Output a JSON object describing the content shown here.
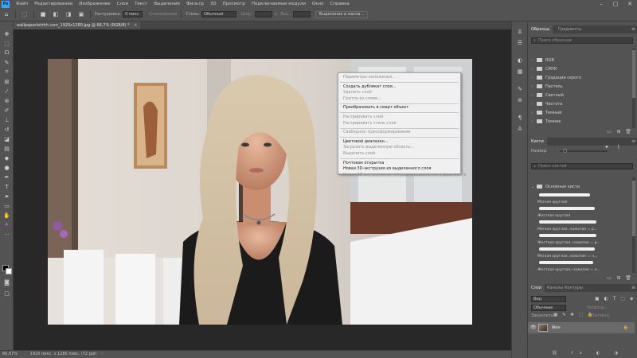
{
  "app": {
    "logo": "Ps"
  },
  "menubar": {
    "items": [
      "Файл",
      "Редактирование",
      "Изображение",
      "Слои",
      "Текст",
      "Выделение",
      "Фильтр",
      "3D",
      "Просмотр",
      "Подключаемые модули",
      "Окно",
      "Справка"
    ],
    "window_controls": [
      "–",
      "□",
      "✕"
    ]
  },
  "options": {
    "feather_label": "Растушевка:",
    "feather_value": "0 пикс.",
    "antialias_label": "Сглаживание",
    "style_label": "Стиль:",
    "style_value": "Обычный",
    "width_label": "Шир.:",
    "height_label": "Выс.:",
    "select_mask_button": "Выделение и маска..."
  },
  "document": {
    "tab_title": "wallpapertotrhh.com_1920x1280.jpg @ 66,7% (RGB/8) *"
  },
  "context_menu": {
    "groups": [
      [
        {
          "label": "Параметры наложения...",
          "enabled": false
        }
      ],
      [
        {
          "label": "Создать дубликат слоя...",
          "enabled": true
        },
        {
          "label": "Удалить слой",
          "enabled": false
        },
        {
          "label": "Группа из слоев...",
          "enabled": false
        }
      ],
      [
        {
          "label": "Преобразовать в смарт-объект",
          "enabled": true
        }
      ],
      [
        {
          "label": "Растрировать слой",
          "enabled": false
        },
        {
          "label": "Растрировать стиль слоя",
          "enabled": false
        }
      ],
      [
        {
          "label": "Свободное трансформирование",
          "enabled": false
        }
      ],
      [
        {
          "label": "Цветовой диапазон...",
          "enabled": true
        },
        {
          "label": "Загрузить выделенную область...",
          "enabled": false
        },
        {
          "label": "Выделить слой",
          "enabled": false
        }
      ],
      [
        {
          "label": "Почтовая открытка",
          "enabled": true
        },
        {
          "label": "Новая 3D-экструзия из выделенного слоя",
          "enabled": true
        },
        {
          "label": "Новая 3D-экструзия из текущего выделенного фрагмента",
          "enabled": false
        }
      ]
    ]
  },
  "statusbar": {
    "zoom": "66,67%",
    "doc_info": "1920 пикс. x 1280 пикс. (72 ppi)"
  },
  "swatches_panel": {
    "tabs": [
      "Образцы",
      "Градиенты"
    ],
    "search_placeholder": "Поиск образцов",
    "folders": [
      "RGB",
      "CMYK",
      "Градации серого",
      "Пастель",
      "Светлый",
      "Чистота",
      "Темный",
      "Темнее"
    ]
  },
  "brushes_panel": {
    "title": "Кисти",
    "size_label": "Размер:",
    "search_placeholder": "Поиск кистей",
    "group_name": "Основные кисти",
    "brushes": [
      "Мягкая круглая",
      "Жесткая круглая",
      "Мягкая круглая, нажатие = р...",
      "Жесткая круглая, нажатие = р...",
      "Мягкая круглая, нажатие = н...",
      "Жесткая круглая, нажатие = н..."
    ]
  },
  "layers_panel": {
    "tabs": [
      "Слои",
      "Каналы",
      "Контуры"
    ],
    "filter_label": "Вид",
    "blend_mode": "Обычные",
    "opacity_label": "Непрозр.:",
    "lock_label": "Закрепить:",
    "fill_label": "Заливка:",
    "layer_name": "Фон"
  },
  "colors": {
    "ui_dark": "#535353",
    "canvas_bg": "#282828",
    "menu_bg": "#f0f0f0",
    "ps_blue": "#31a8ff"
  }
}
